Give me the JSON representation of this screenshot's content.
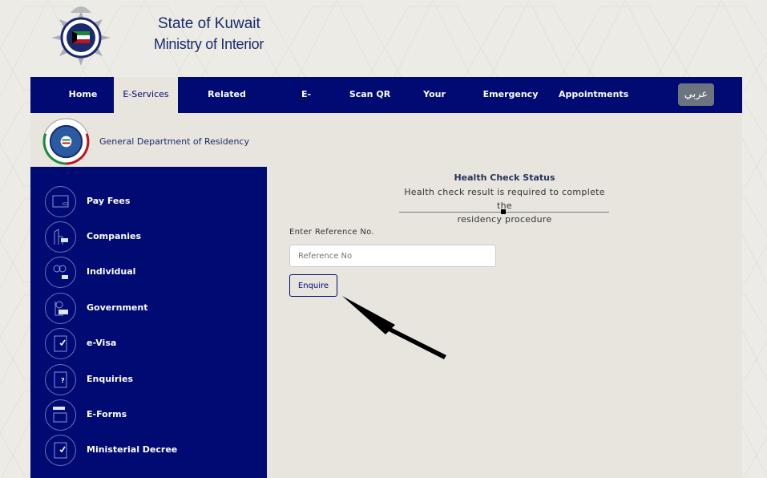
{
  "header": {
    "title_line1": "State of Kuwait",
    "title_line2": "Ministry of Interior",
    "logo_icon": "kuwait-police-emblem"
  },
  "nav": {
    "items": [
      {
        "label": "Home",
        "active": false
      },
      {
        "label": "E-Services",
        "active": true
      },
      {
        "label": "Related Departments",
        "active": false
      },
      {
        "label": "E-Publishing",
        "active": false
      },
      {
        "label": "Scan QR",
        "active": false
      },
      {
        "label": "Your Opinion",
        "active": false
      },
      {
        "label": "Emergency Contact",
        "active": false
      },
      {
        "label": "Appointments",
        "active": false
      }
    ],
    "language_button": "عربي"
  },
  "department": {
    "name": "General Department of Residency",
    "logo_icon": "residency-emblem"
  },
  "sidebar": {
    "items": [
      {
        "label": "Pay Fees",
        "icon": "kd-card-icon"
      },
      {
        "label": "Companies",
        "icon": "building-icon"
      },
      {
        "label": "Individual",
        "icon": "people-icon"
      },
      {
        "label": "Government",
        "icon": "government-icon"
      },
      {
        "label": "e-Visa",
        "icon": "visa-check-icon"
      },
      {
        "label": "Enquiries",
        "icon": "question-doc-icon"
      },
      {
        "label": "E-Forms",
        "icon": "eforms-icon"
      },
      {
        "label": "Ministerial Decree",
        "icon": "decree-check-icon"
      }
    ]
  },
  "main": {
    "section_title": "Health Check Status",
    "section_desc_line1": "Health check result is required to complete the",
    "section_desc_line2": "residency procedure",
    "ref_label": "Enter Reference No.",
    "ref_placeholder": "Reference No",
    "ref_value": "",
    "enquire_label": "Enquire"
  },
  "colors": {
    "navy": "#000a73",
    "panel_bg": "#e8e5de",
    "lang_button": "#6c757d"
  }
}
